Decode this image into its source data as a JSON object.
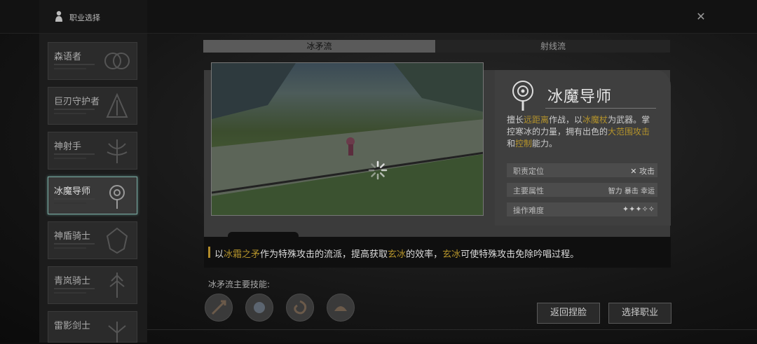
{
  "header": {
    "title": "职业选择",
    "close_icon": "close-icon"
  },
  "classes": [
    {
      "name": "森语者",
      "emblem": "leaf-ring-emblem-icon"
    },
    {
      "name": "巨刃守护者",
      "emblem": "blade-emblem-icon"
    },
    {
      "name": "神射手",
      "emblem": "arrow-emblem-icon"
    },
    {
      "name": "冰魔导师",
      "emblem": "frost-staff-emblem-icon",
      "active": true
    },
    {
      "name": "神盾骑士",
      "emblem": "shield-emblem-icon"
    },
    {
      "name": "青岚骑士",
      "emblem": "spear-emblem-icon"
    },
    {
      "name": "雷影剑士",
      "emblem": "thunder-emblem-icon"
    }
  ],
  "tabs": [
    {
      "label": "冰矛流",
      "active": true
    },
    {
      "label": "射线流",
      "active": false
    }
  ],
  "info": {
    "class_name": "冰魔导师",
    "desc_parts": [
      "擅长",
      "远距离",
      "作战，以",
      "冰魔杖",
      "为武器。掌控寒冰的力量，拥有出色的",
      "大范围攻击",
      "和",
      "控制",
      "能力。"
    ],
    "attributes": [
      {
        "label": "职责定位",
        "value": "攻击",
        "icon": "crossed-swords-icon"
      },
      {
        "label": "主要属性",
        "value": "智力 暴击 幸运"
      },
      {
        "label": "操作难度",
        "value": "✦✦✦✧✧"
      }
    ]
  },
  "banner": {
    "parts": [
      "以",
      "冰霜之矛",
      "作为特殊攻击的流派，提高获取",
      "玄冰",
      "的效率，",
      "玄冰",
      "可使特殊攻击免除吟唱过程。"
    ]
  },
  "skills": {
    "label": "冰矛流主要技能:",
    "icons": [
      "ice-spear-skill-icon",
      "frost-orb-skill-icon",
      "vortex-skill-icon",
      "blizzard-skill-icon"
    ]
  },
  "buttons": {
    "back": "返回捏脸",
    "select": "选择职业"
  },
  "colors": {
    "highlight": "#b4932b",
    "active_border": "#7aa8a0"
  }
}
